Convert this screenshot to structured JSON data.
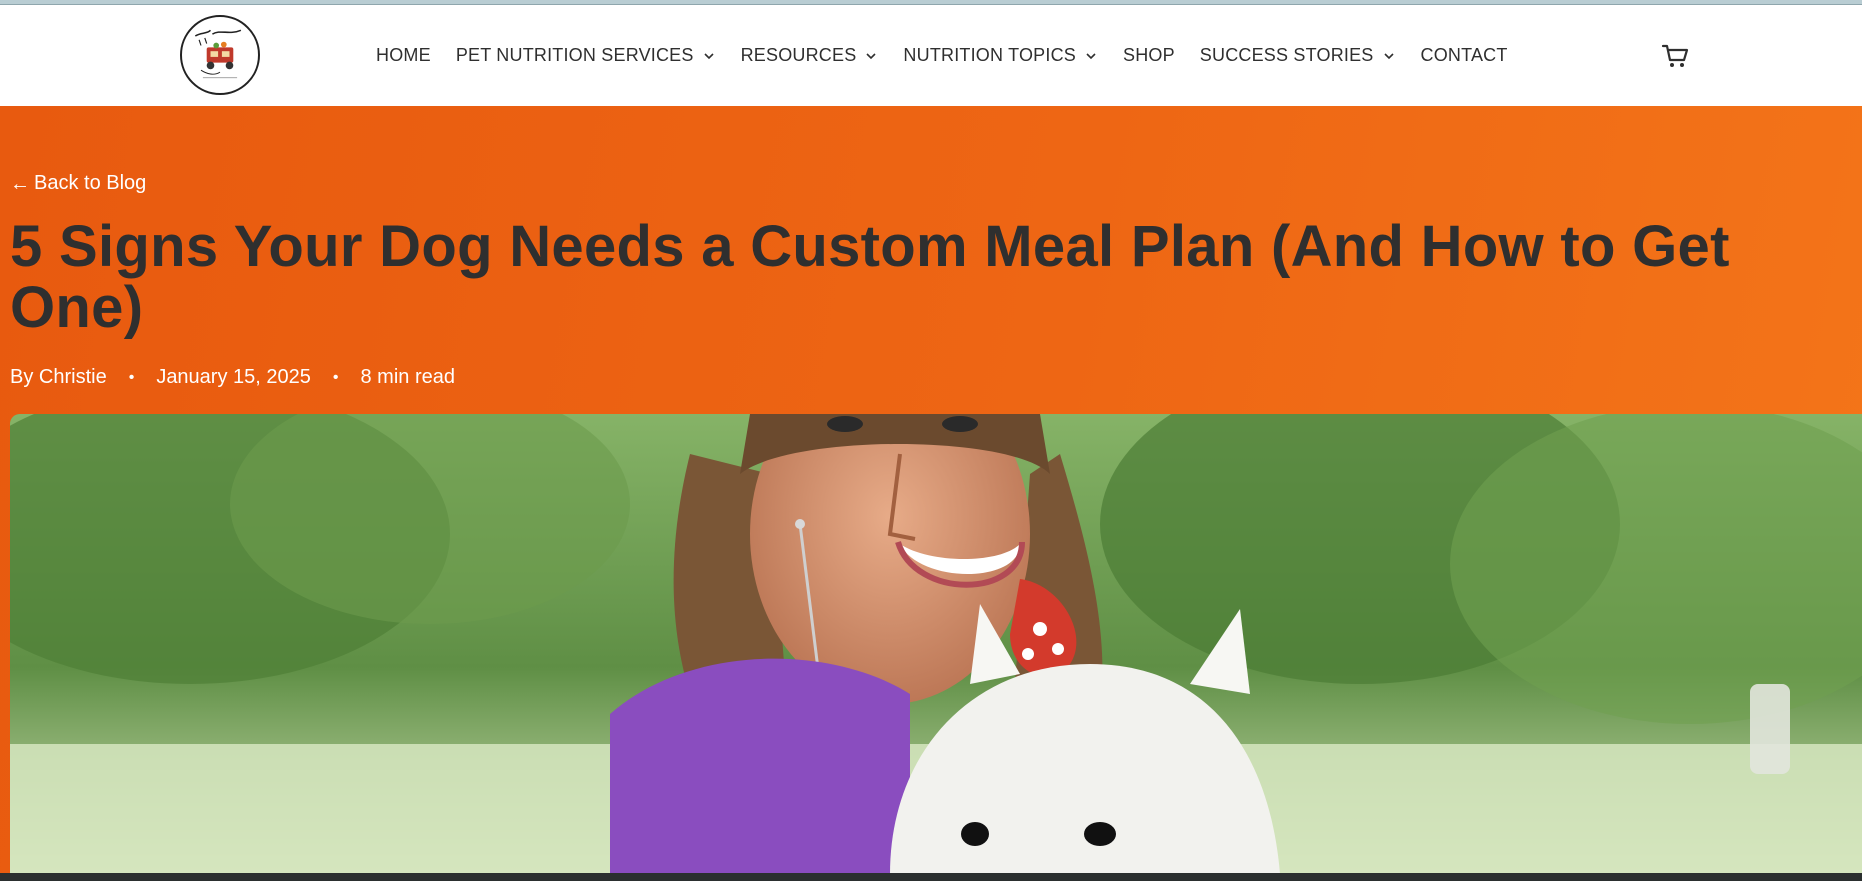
{
  "header": {
    "logo_alt": "Waggin Meals",
    "nav": [
      {
        "label": "HOME",
        "has_dropdown": false
      },
      {
        "label": "PET NUTRITION SERVICES",
        "has_dropdown": true
      },
      {
        "label": "RESOURCES",
        "has_dropdown": true
      },
      {
        "label": "NUTRITION TOPICS",
        "has_dropdown": true
      },
      {
        "label": "SHOP",
        "has_dropdown": false
      },
      {
        "label": "SUCCESS STORIES",
        "has_dropdown": true
      },
      {
        "label": "CONTACT",
        "has_dropdown": false
      }
    ],
    "cart_icon": "shopping-cart-icon"
  },
  "hero": {
    "back_label": "Back to Blog",
    "back_arrow": "←",
    "title": "5 Signs Your Dog Needs a Custom Meal Plan (And How to Get One)",
    "author": "By Christie",
    "date": "January 15, 2025",
    "read_time": "8 min read",
    "separator": "•",
    "image_alt": "Smiling woman in a purple shirt holding a white West Highland terrier outdoors"
  },
  "colors": {
    "accent_orange": "#ee6614",
    "title_text": "#2f2f2f",
    "nav_text": "#2f2f2f"
  }
}
